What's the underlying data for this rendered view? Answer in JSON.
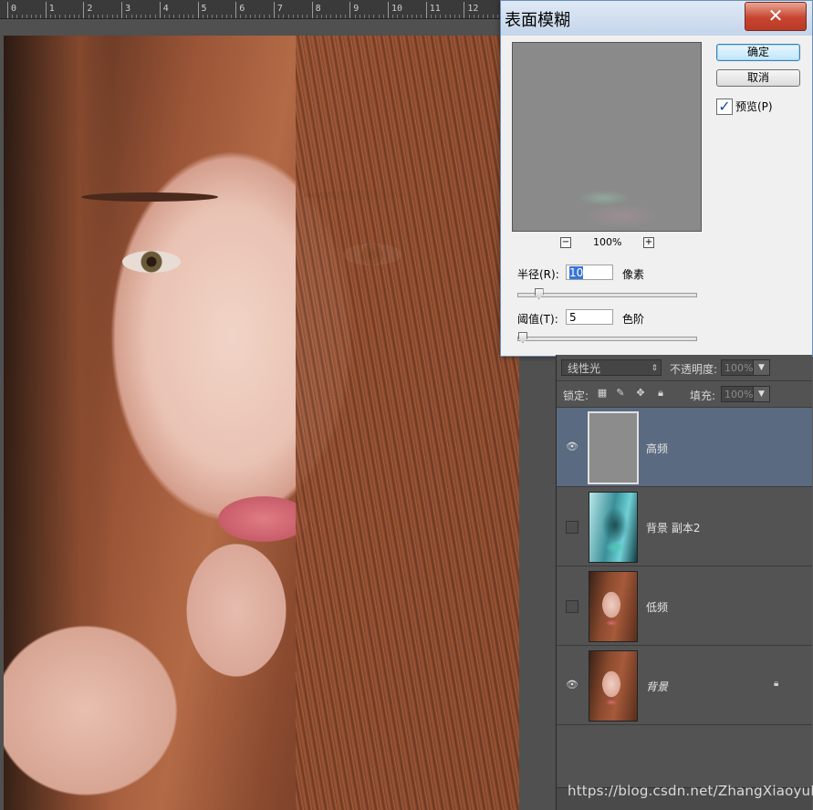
{
  "ruler": {
    "labels": [
      "0",
      "1",
      "2",
      "3",
      "4",
      "5",
      "6",
      "7",
      "8",
      "9",
      "10",
      "11",
      "12"
    ]
  },
  "dialog": {
    "title": "表面模糊",
    "close_glyph": "✕",
    "ok_label": "确定",
    "cancel_label": "取消",
    "preview_label": "预览(P)",
    "preview_checked": true,
    "zoom_minus": "−",
    "zoom_plus": "+",
    "zoom_level": "100%",
    "radius": {
      "label": "半径(R):",
      "value": "10",
      "unit": "像素",
      "slider_fraction": 0.09
    },
    "threshold": {
      "label": "阈值(T):",
      "value": "5",
      "unit": "色阶",
      "slider_fraction": 0.0
    }
  },
  "layers_panel": {
    "blend_mode": "线性光",
    "opacity_label": "不透明度:",
    "opacity_value": "100%",
    "lock_label": "锁定:",
    "fill_label": "填充:",
    "fill_value": "100%",
    "layers": [
      {
        "name": "高频",
        "visible": true,
        "active": true,
        "locked": false,
        "thumb": "gray"
      },
      {
        "name": "背景 副本2",
        "visible": false,
        "active": false,
        "locked": false,
        "thumb": "inverted"
      },
      {
        "name": "低频",
        "visible": false,
        "active": false,
        "locked": false,
        "thumb": "photo"
      },
      {
        "name": "背景",
        "visible": true,
        "active": false,
        "locked": true,
        "thumb": "photo"
      }
    ]
  },
  "watermark": "https://blog.csdn.net/ZhangXiaoyuBK",
  "icons": {
    "eye": "eye-icon",
    "lock": "lock-icon",
    "checkmark": "checkmark-icon"
  }
}
